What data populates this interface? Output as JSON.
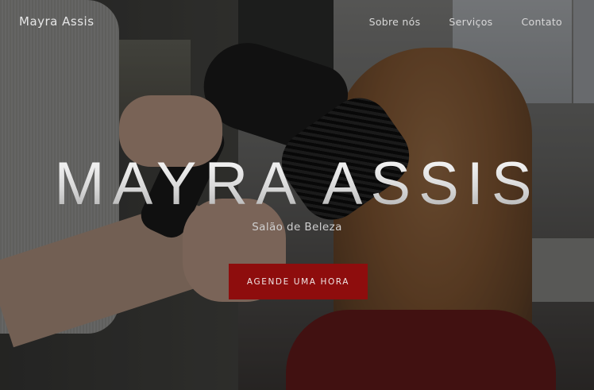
{
  "header": {
    "brand": "Mayra Assis",
    "nav": [
      {
        "label": "Sobre nós"
      },
      {
        "label": "Serviços"
      },
      {
        "label": "Contato"
      }
    ]
  },
  "hero": {
    "title": "MAYRA ASSIS",
    "subtitle": "Salão de Beleza",
    "cta_label": "AGENDE UMA HORA",
    "image": "hairdresser-blow-drying-photo"
  },
  "colors": {
    "cta_background": "#8e0d0d",
    "text": "#eeeeee"
  }
}
